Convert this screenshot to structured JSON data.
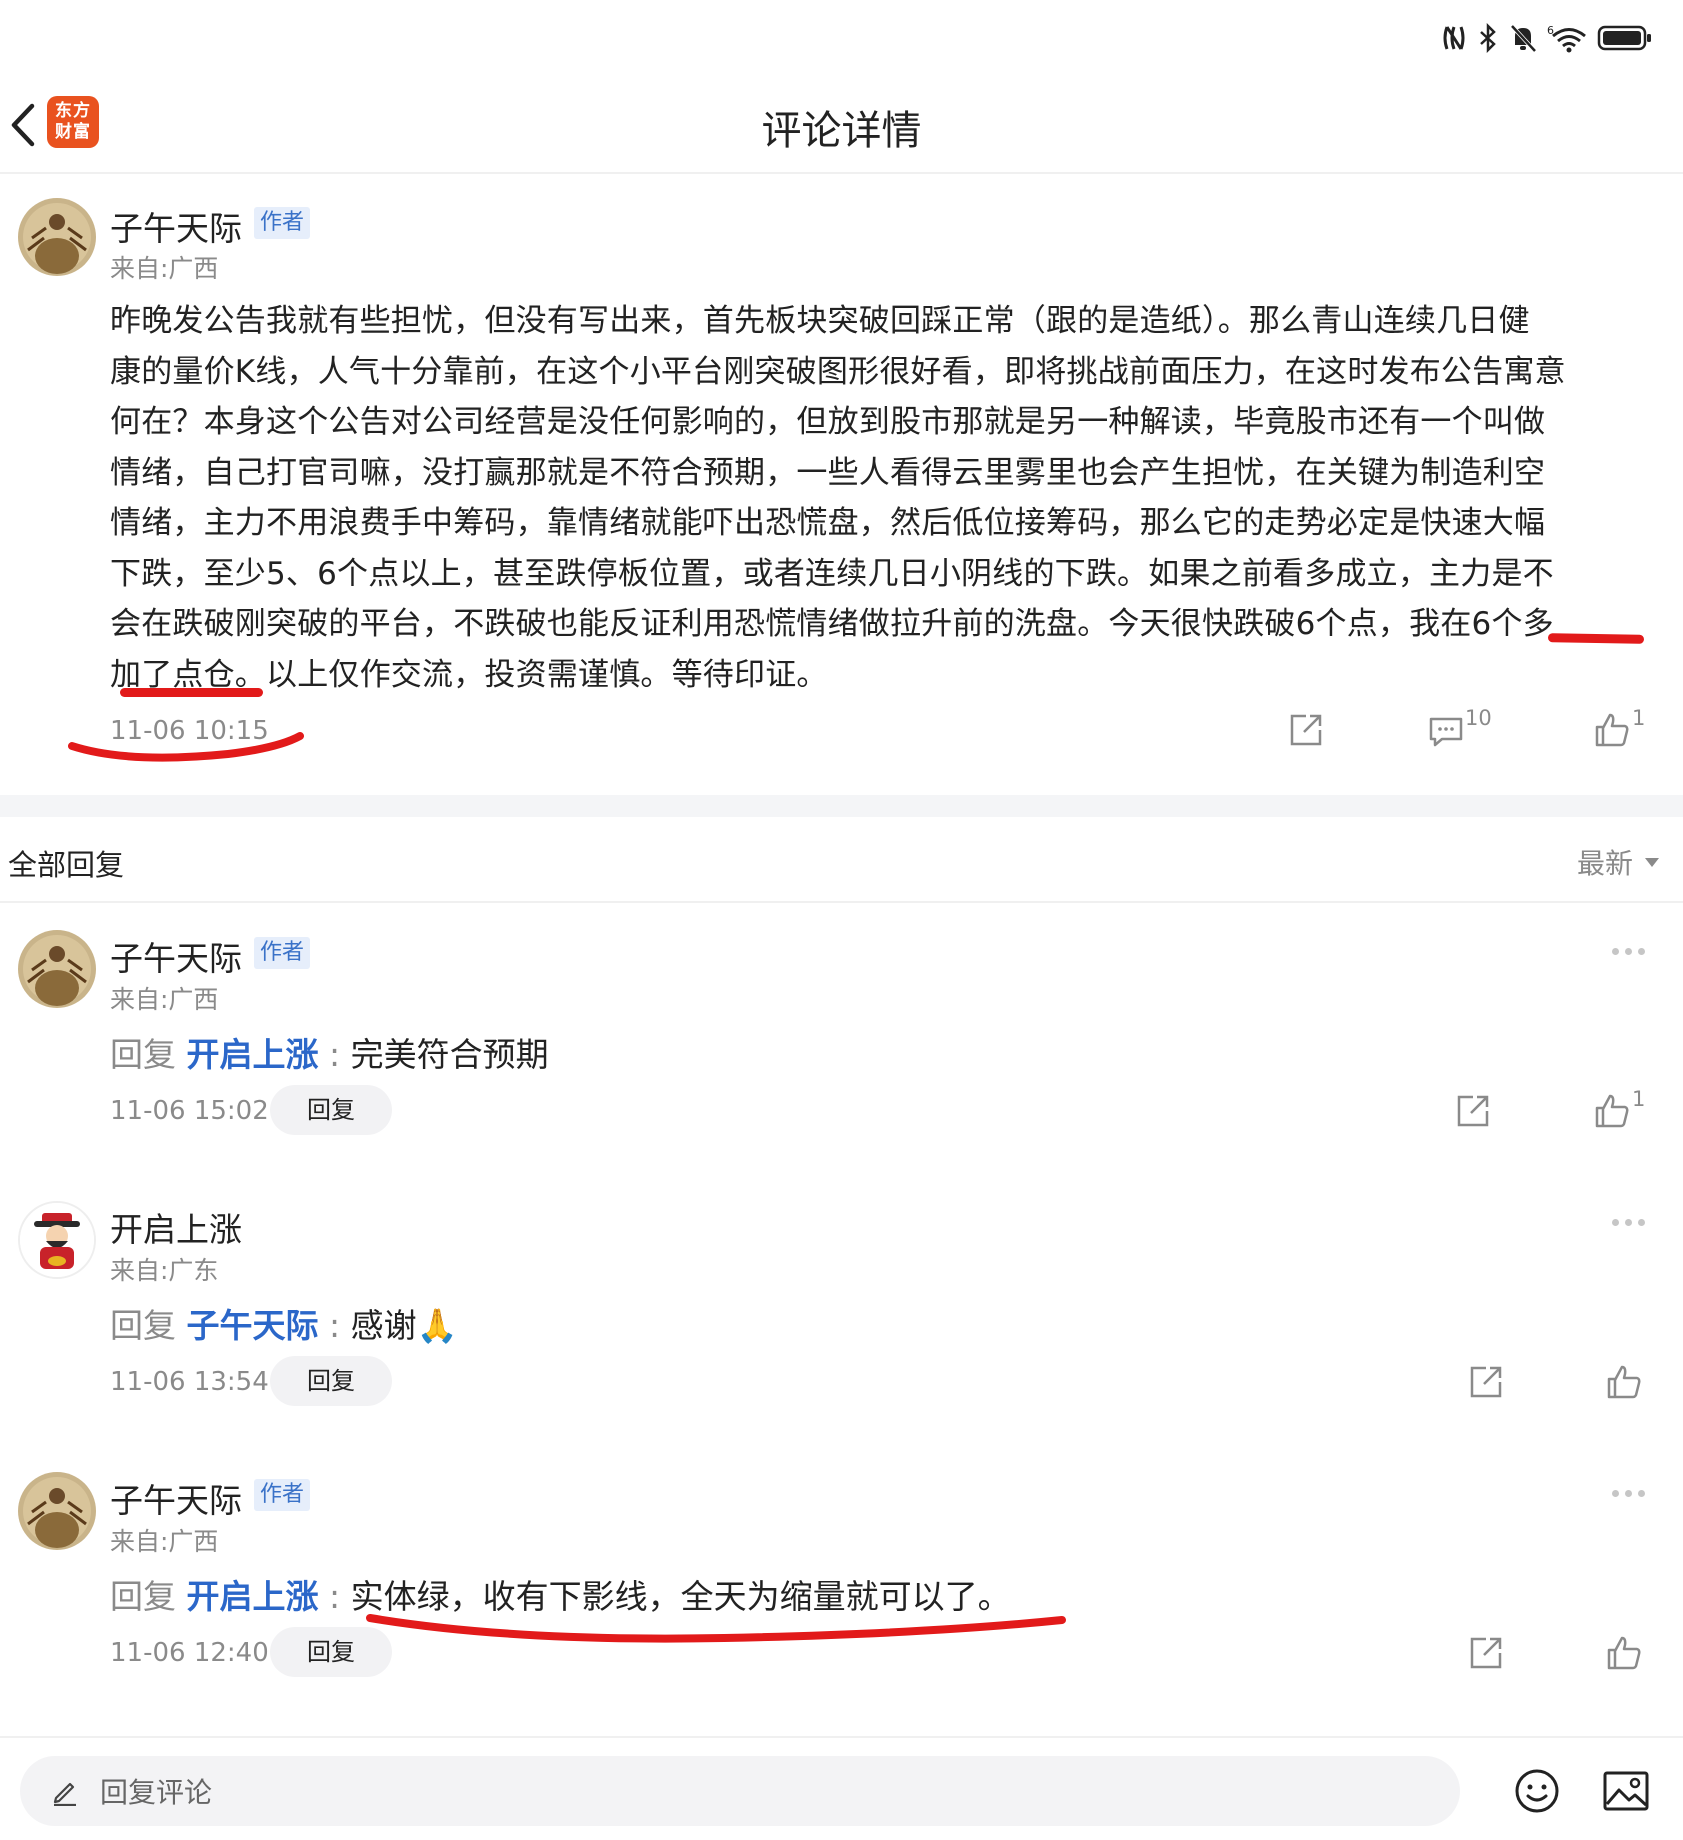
{
  "header": {
    "title": "评论详情",
    "logo_text_line1": "东方",
    "logo_text_line2": "财富"
  },
  "post": {
    "author": "子午天际",
    "badge": "作者",
    "location": "来自:广西",
    "lines": [
      "昨晚发公告我就有些担忧，但没有写出来，首先板块突破回踩正常（跟的是造纸）。那么青山连续几日健",
      "康的量价K线，人气十分靠前，在这个小平台刚突破图形很好看，即将挑战前面压力，在这时发布公告寓意",
      "何在？本身这个公告对公司经营是没任何影响的，但放到股市那就是另一种解读，毕竟股市还有一个叫做",
      "情绪，自己打官司嘛，没打赢那就是不符合预期，一些人看得云里雾里也会产生担忧，在关键为制造利空",
      "情绪，主力不用浪费手中筹码，靠情绪就能吓出恐慌盘，然后低位接筹码，那么它的走势必定是快速大幅",
      "下跌，至少5、6个点以上，甚至跌停板位置，或者连续几日小阴线的下跌。如果之前看多成立，主力是不",
      "会在跌破刚突破的平台，不跌破也能反证利用恐慌情绪做拉升前的洗盘。今天很快跌破6个点，我在6个多",
      "加了点仓。以上仅作交流，投资需谨慎。等待印证。"
    ],
    "time": "11-06 10:15",
    "comment_count": "10",
    "like_count": "1"
  },
  "replies_header": {
    "title": "全部回复",
    "sort": "最新"
  },
  "replies": [
    {
      "author": "子午天际",
      "badge": "作者",
      "location": "来自:广西",
      "prefix": "回复",
      "target": "开启上涨",
      "separator": ":",
      "text": "完美符合预期",
      "time": "11-06 15:02",
      "reply_label": "回复",
      "like_count": "1"
    },
    {
      "author": "开启上涨",
      "location": "来自:广东",
      "prefix": "回复",
      "target": "子午天际",
      "separator": ":",
      "text": "感谢🙏",
      "time": "11-06 13:54",
      "reply_label": "回复"
    },
    {
      "author": "子午天际",
      "badge": "作者",
      "location": "来自:广西",
      "prefix": "回复",
      "target": "开启上涨",
      "separator": ":",
      "text": "实体绿，收有下影线，全天为缩量就可以了。",
      "time": "11-06 12:40",
      "reply_label": "回复"
    }
  ],
  "bottom_bar": {
    "input_placeholder": "回复评论"
  },
  "colors": {
    "link_blue": "#2b67c9",
    "annotation_red": "#e21a1a",
    "logo_orange": "#e9521f"
  }
}
